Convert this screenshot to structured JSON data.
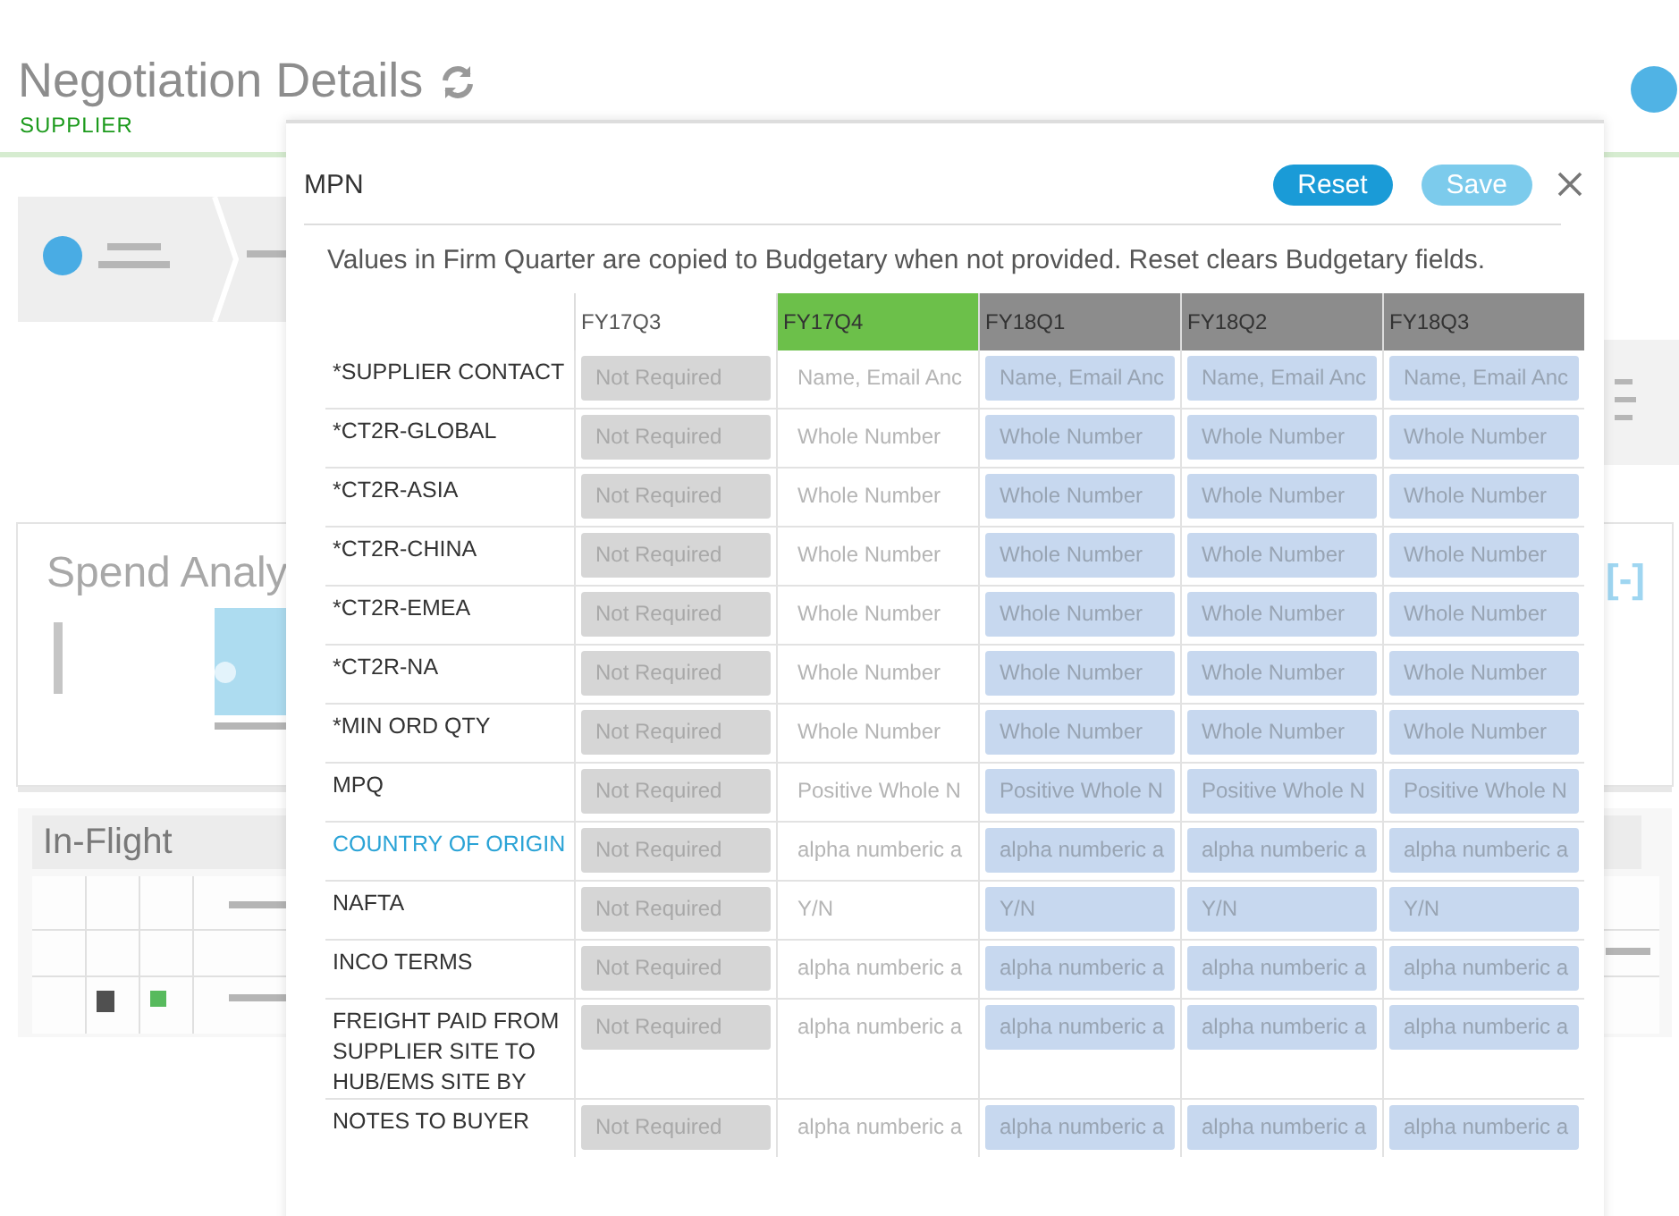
{
  "page": {
    "title": "Negotiation Details",
    "subtitle": "SUPPLIER",
    "spend_card": {
      "title": "Spend Analy",
      "toggle": "[-]"
    },
    "inflight_card": {
      "title": "In-Flight"
    }
  },
  "dialog": {
    "title": "MPN",
    "buttons": [
      {
        "label": "Reset",
        "disabled": false
      },
      {
        "label": "Save",
        "disabled": true
      }
    ],
    "note": "Values in Firm Quarter are copied to Budgetary when not provided. Reset clears Budgetary fields.",
    "columns": [
      {
        "label": "FY17Q3",
        "kind": "locked"
      },
      {
        "label": "FY17Q4",
        "kind": "firm"
      },
      {
        "label": "FY18Q1",
        "kind": "budgetary"
      },
      {
        "label": "FY18Q2",
        "kind": "budgetary"
      },
      {
        "label": "FY18Q3",
        "kind": "budgetary"
      }
    ],
    "rows": [
      {
        "label": "*SUPPLIER CONTACT",
        "kind": "plain",
        "cells": [
          "Not Required",
          "Name, Email Anc",
          "Name, Email Anc",
          "Name, Email Anc",
          "Name, Email Anc"
        ]
      },
      {
        "label": "*CT2R-GLOBAL",
        "kind": "plain",
        "cells": [
          "Not Required",
          "Whole Number",
          "Whole Number",
          "Whole Number",
          "Whole Number"
        ]
      },
      {
        "label": "*CT2R-ASIA",
        "kind": "plain",
        "cells": [
          "Not Required",
          "Whole Number",
          "Whole Number",
          "Whole Number",
          "Whole Number"
        ]
      },
      {
        "label": "*CT2R-CHINA",
        "kind": "plain",
        "cells": [
          "Not Required",
          "Whole Number",
          "Whole Number",
          "Whole Number",
          "Whole Number"
        ]
      },
      {
        "label": "*CT2R-EMEA",
        "kind": "plain",
        "cells": [
          "Not Required",
          "Whole Number",
          "Whole Number",
          "Whole Number",
          "Whole Number"
        ]
      },
      {
        "label": "*CT2R-NA",
        "kind": "plain",
        "cells": [
          "Not Required",
          "Whole Number",
          "Whole Number",
          "Whole Number",
          "Whole Number"
        ]
      },
      {
        "label": "*MIN ORD QTY",
        "kind": "plain",
        "cells": [
          "Not Required",
          "Whole Number",
          "Whole Number",
          "Whole Number",
          "Whole Number"
        ]
      },
      {
        "label": "MPQ",
        "kind": "plain",
        "cells": [
          "Not Required",
          "Positive Whole N",
          "Positive Whole N",
          "Positive Whole N",
          "Positive Whole N"
        ]
      },
      {
        "label": "COUNTRY OF ORIGIN",
        "kind": "link",
        "cells": [
          "Not Required",
          "alpha numberic a",
          "alpha numberic a",
          "alpha numberic a",
          "alpha numberic a"
        ]
      },
      {
        "label": "NAFTA",
        "kind": "plain",
        "cells": [
          "Not Required",
          "Y/N",
          "Y/N",
          "Y/N",
          "Y/N"
        ]
      },
      {
        "label": "INCO TERMS",
        "kind": "plain",
        "cells": [
          "Not Required",
          "alpha numberic a",
          "alpha numberic a",
          "alpha numberic a",
          "alpha numberic a"
        ]
      },
      {
        "label": "FREIGHT PAID FROM SUPPLIER SITE TO HUB/EMS SITE BY",
        "kind": "plain",
        "cells": [
          "Not Required",
          "alpha numberic a",
          "alpha numberic a",
          "alpha numberic a",
          "alpha numberic a"
        ]
      },
      {
        "label": "NOTES TO BUYER",
        "kind": "plain",
        "cells": [
          "Not Required",
          "alpha numberic a",
          "alpha numberic a",
          "alpha numberic a",
          "alpha numberic a"
        ]
      }
    ]
  }
}
